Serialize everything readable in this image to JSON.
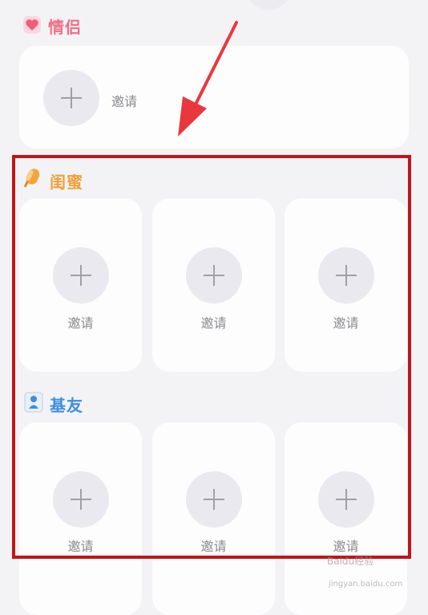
{
  "sections": {
    "couple": {
      "title": "情侣",
      "invite_label": "邀请"
    },
    "bestie": {
      "title": "闺蜜",
      "slots": [
        {
          "invite_label": "邀请"
        },
        {
          "invite_label": "邀请"
        },
        {
          "invite_label": "邀请"
        }
      ]
    },
    "buddy": {
      "title": "基友",
      "slots": [
        {
          "invite_label": "邀请"
        },
        {
          "invite_label": "邀请"
        },
        {
          "invite_label": "邀请"
        }
      ]
    }
  },
  "watermark": {
    "text": "Baidu经验",
    "sub": "jingyan.baidu.com"
  },
  "colors": {
    "couple_title": "#f26d86",
    "bestie_title": "#f0a03a",
    "buddy_title": "#3d8fe0",
    "highlight_frame": "#c0161a",
    "arrow": "#e8383d"
  },
  "icons": {
    "couple": "heart-icon",
    "bestie": "popsicle-icon",
    "buddy": "person-icon"
  }
}
